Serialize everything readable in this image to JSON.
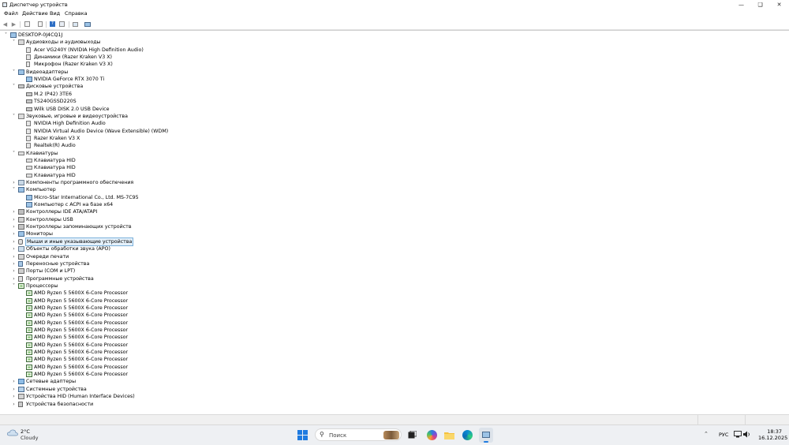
{
  "window": {
    "title": "Диспетчер устройств"
  },
  "menu": [
    "Файл",
    "Действие",
    "Вид",
    "Справка"
  ],
  "toolbar": [
    "back-arrow-icon",
    "forward-arrow-icon",
    "properties-icon",
    "update-driver-icon",
    "help-icon",
    "view-icon",
    "scan-icon",
    "monitor-icon"
  ],
  "tree": [
    {
      "level": 0,
      "text": "DESKTOP-0J4CQ1J",
      "expanded": true,
      "icon": "computer-icon"
    },
    {
      "level": 1,
      "text": "Аудиовходы и аудиовыходы",
      "expanded": true,
      "icon": "audio-io-icon"
    },
    {
      "level": 2,
      "text": "Acer VG240Y (NVIDIA High Definition Audio)",
      "icon": "speaker-icon"
    },
    {
      "level": 2,
      "text": "Динамики (Razer Kraken V3 X)",
      "icon": "speaker-icon"
    },
    {
      "level": 2,
      "text": "Микрофон (Razer Kraken V3 X)",
      "icon": "microphone-icon"
    },
    {
      "level": 1,
      "text": "Видеоадаптеры",
      "expanded": true,
      "icon": "display-adapter-icon"
    },
    {
      "level": 2,
      "text": "NVIDIA GeForce RTX 3070 Ti",
      "icon": "display-adapter-icon"
    },
    {
      "level": 1,
      "text": "Дисковые устройства",
      "expanded": true,
      "icon": "disk-icon"
    },
    {
      "level": 2,
      "text": "M.2 (P42) 3TE6",
      "icon": "disk-icon"
    },
    {
      "level": 2,
      "text": "TS240GSSD220S",
      "icon": "disk-icon"
    },
    {
      "level": 2,
      "text": "Wilk USB DISK 2.0 USB Device",
      "icon": "disk-icon"
    },
    {
      "level": 1,
      "text": "Звуковые, игровые и видеоустройства",
      "expanded": true,
      "icon": "sound-icon"
    },
    {
      "level": 2,
      "text": "NVIDIA High Definition Audio",
      "icon": "speaker-icon"
    },
    {
      "level": 2,
      "text": "NVIDIA Virtual Audio Device (Wave Extensible) (WDM)",
      "icon": "speaker-icon"
    },
    {
      "level": 2,
      "text": "Razer Kraken V3 X",
      "icon": "speaker-icon"
    },
    {
      "level": 2,
      "text": "Realtek(R) Audio",
      "icon": "speaker-icon"
    },
    {
      "level": 1,
      "text": "Клавиатуры",
      "expanded": true,
      "icon": "keyboard-icon"
    },
    {
      "level": 2,
      "text": "Клавиатура HID",
      "icon": "keyboard-icon"
    },
    {
      "level": 2,
      "text": "Клавиатура HID",
      "icon": "keyboard-icon"
    },
    {
      "level": 2,
      "text": "Клавиатура HID",
      "icon": "keyboard-icon"
    },
    {
      "level": 1,
      "text": "Компоненты программного обеспечения",
      "expanded": false,
      "icon": "software-component-icon"
    },
    {
      "level": 1,
      "text": "Компьютер",
      "expanded": true,
      "icon": "computer-icon"
    },
    {
      "level": 2,
      "text": "Micro-Star International Co., Ltd. MS-7C95",
      "icon": "monitor-icon"
    },
    {
      "level": 2,
      "text": "Компьютер с ACPI на базе x64",
      "icon": "monitor-icon"
    },
    {
      "level": 1,
      "text": "Контроллеры IDE ATA/ATAPI",
      "expanded": false,
      "icon": "ide-controller-icon"
    },
    {
      "level": 1,
      "text": "Контроллеры USB",
      "expanded": false,
      "icon": "usb-icon"
    },
    {
      "level": 1,
      "text": "Контроллеры запоминающих устройств",
      "expanded": false,
      "icon": "storage-controller-icon"
    },
    {
      "level": 1,
      "text": "Мониторы",
      "expanded": false,
      "icon": "monitor-icon"
    },
    {
      "level": 1,
      "text": "Мыши и иные указывающие устройства",
      "expanded": false,
      "icon": "mouse-icon",
      "selected": true
    },
    {
      "level": 1,
      "text": "Объекты обработки звука (APO)",
      "expanded": false,
      "icon": "audio-processing-icon"
    },
    {
      "level": 1,
      "text": "Очереди печати",
      "expanded": false,
      "icon": "printer-icon"
    },
    {
      "level": 1,
      "text": "Переносные устройства",
      "expanded": false,
      "icon": "portable-device-icon"
    },
    {
      "level": 1,
      "text": "Порты (COM и LPT)",
      "expanded": false,
      "icon": "port-icon"
    },
    {
      "level": 1,
      "text": "Программные устройства",
      "expanded": false,
      "icon": "software-device-icon"
    },
    {
      "level": 1,
      "text": "Процессоры",
      "expanded": true,
      "icon": "processor-icon"
    },
    {
      "level": 2,
      "text": "AMD Ryzen 5 5600X 6-Core Processor",
      "icon": "processor-icon"
    },
    {
      "level": 2,
      "text": "AMD Ryzen 5 5600X 6-Core Processor",
      "icon": "processor-icon"
    },
    {
      "level": 2,
      "text": "AMD Ryzen 5 5600X 6-Core Processor",
      "icon": "processor-icon"
    },
    {
      "level": 2,
      "text": "AMD Ryzen 5 5600X 6-Core Processor",
      "icon": "processor-icon"
    },
    {
      "level": 2,
      "text": "AMD Ryzen 5 5600X 6-Core Processor",
      "icon": "processor-icon"
    },
    {
      "level": 2,
      "text": "AMD Ryzen 5 5600X 6-Core Processor",
      "icon": "processor-icon"
    },
    {
      "level": 2,
      "text": "AMD Ryzen 5 5600X 6-Core Processor",
      "icon": "processor-icon"
    },
    {
      "level": 2,
      "text": "AMD Ryzen 5 5600X 6-Core Processor",
      "icon": "processor-icon"
    },
    {
      "level": 2,
      "text": "AMD Ryzen 5 5600X 6-Core Processor",
      "icon": "processor-icon"
    },
    {
      "level": 2,
      "text": "AMD Ryzen 5 5600X 6-Core Processor",
      "icon": "processor-icon"
    },
    {
      "level": 2,
      "text": "AMD Ryzen 5 5600X 6-Core Processor",
      "icon": "processor-icon"
    },
    {
      "level": 2,
      "text": "AMD Ryzen 5 5600X 6-Core Processor",
      "icon": "processor-icon"
    },
    {
      "level": 1,
      "text": "Сетевые адаптеры",
      "expanded": false,
      "icon": "network-adapter-icon"
    },
    {
      "level": 1,
      "text": "Системные устройства",
      "expanded": false,
      "icon": "system-device-icon"
    },
    {
      "level": 1,
      "text": "Устройства HID (Human Interface Devices)",
      "expanded": false,
      "icon": "hid-icon"
    },
    {
      "level": 1,
      "text": "Устройства безопасности",
      "expanded": false,
      "icon": "security-device-icon"
    }
  ],
  "taskbar": {
    "weather": {
      "temp": "2°C",
      "condition": "Cloudy"
    },
    "search_placeholder": "Поиск",
    "language": "РУС",
    "time": "18:37",
    "date": "16.12.2025"
  }
}
